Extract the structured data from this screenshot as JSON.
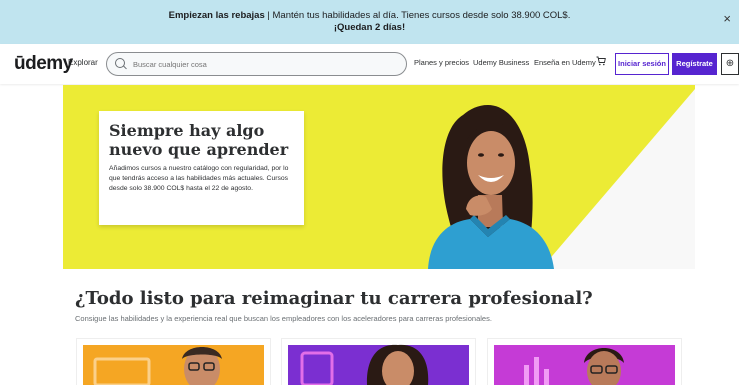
{
  "promo": {
    "bold_text": "Empiezan las rebajas",
    "text": " | Mantén tus habilidades al día. Tienes cursos desde solo 38.900 COL$.",
    "countdown": "¡Quedan 2 días!",
    "close": "×"
  },
  "header": {
    "logo": "ūdemy",
    "explore": "Explorar",
    "search_placeholder": "Buscar cualquier cosa",
    "nav": {
      "plans": "Planes y precios",
      "business": "Udemy Business",
      "teach": "Enseña en Udemy"
    },
    "login": "Iniciar sesión",
    "signup": "Regístrate",
    "globe": "⊕"
  },
  "hero": {
    "title": "Siempre hay algo nuevo que aprender",
    "body": "Añadimos cursos a nuestro catálogo con regularidad, por lo que tendrás acceso a las habilidades más actuales. Cursos desde solo 38.900 COL$ hasta el 22 de agosto."
  },
  "section": {
    "title": "¿Todo listo para reimaginar tu carrera profesional?",
    "subtitle": "Consigue las habilidades y la experiencia real que buscan los empleadores con los aceleradores para carreras profesionales."
  },
  "colors": {
    "promo_bg": "#c0e4ef",
    "brand_purple": "#5624d0",
    "hero_yellow": "#eceb35",
    "card1": "#f5a623",
    "card2": "#7b2fd1",
    "card3": "#c53bd6"
  }
}
